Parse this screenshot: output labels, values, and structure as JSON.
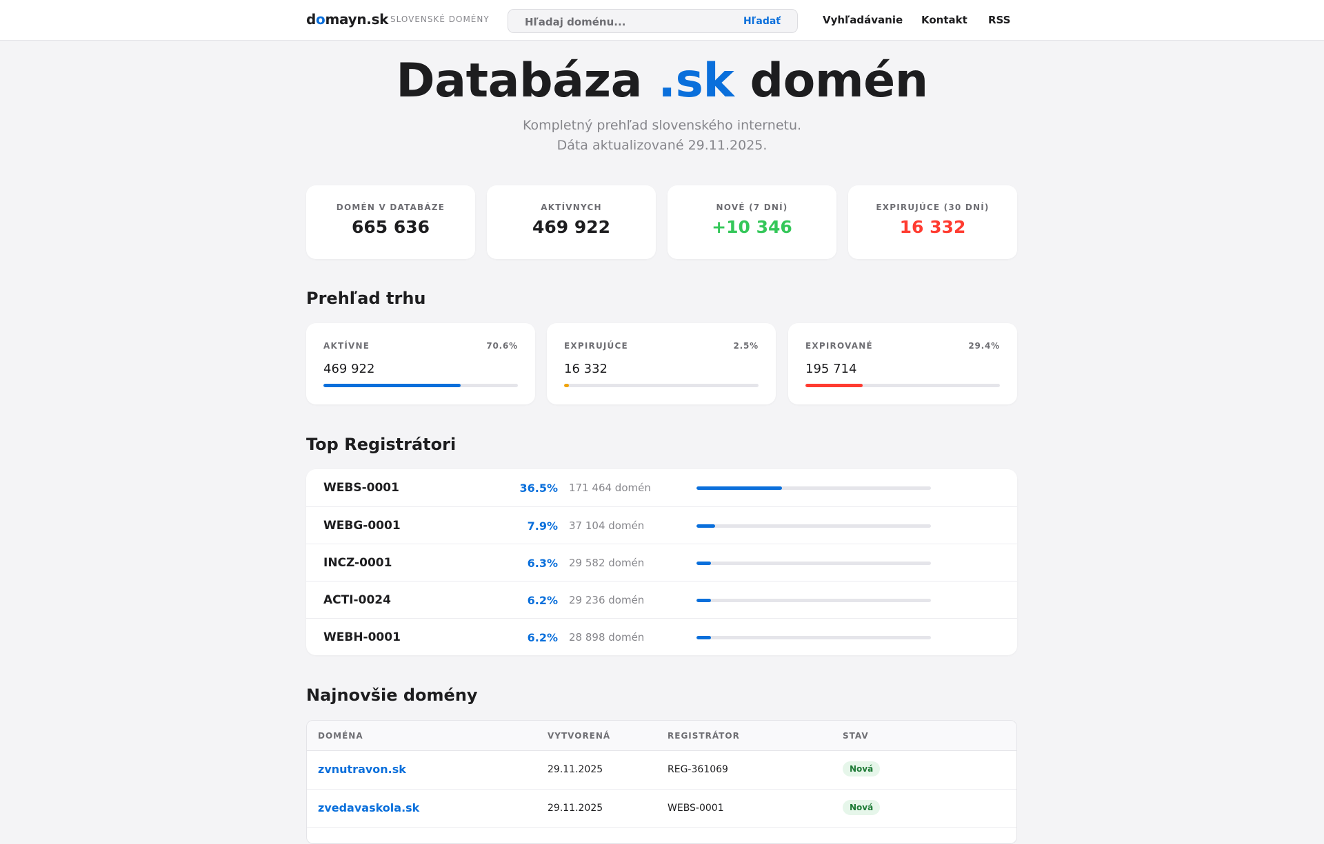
{
  "header": {
    "logo_prefix": "d",
    "logo_o": "o",
    "logo_suffix": "mayn.sk",
    "logo_tagline": "SLOVENSKÉ DOMÉNY",
    "search_placeholder": "Hľadaj doménu...",
    "search_button": "Hľadať",
    "nav": [
      "Vyhľadávanie",
      "Kontakt",
      "RSS"
    ]
  },
  "hero": {
    "title_before": "Databáza",
    "title_accent": ".sk",
    "title_after": "domén",
    "subtitle_line1": "Kompletný prehľad slovenského internetu.",
    "subtitle_line2": "Dáta aktualizované 29.11.2025."
  },
  "colors": {
    "accent": "#0a6fdb",
    "positive": "#34c759",
    "negative": "#ff3b30",
    "warning": "#f0a30a"
  },
  "stats": [
    {
      "label": "DOMÉN V DATABÁZE",
      "value": "665 636",
      "color": "#1d1d1f"
    },
    {
      "label": "AKTÍVNYCH",
      "value": "469 922",
      "color": "#1d1d1f"
    },
    {
      "label": "NOVÉ (7 DNÍ)",
      "value": "+10 346",
      "color": "#34c759"
    },
    {
      "label": "EXPIRUJÚCE (30 DNÍ)",
      "value": "16 332",
      "color": "#ff3b30"
    }
  ],
  "market": {
    "title": "Prehľad trhu",
    "cards": [
      {
        "label": "AKTÍVNE",
        "percent_text": "70.6%",
        "count": "469 922",
        "fraction": 0.706,
        "color": "#0a6fdb"
      },
      {
        "label": "EXPIRUJÚCE",
        "percent_text": "2.5%",
        "count": "16 332",
        "fraction": 0.025,
        "color": "#f0a30a"
      },
      {
        "label": "EXPIROVANÉ",
        "percent_text": "29.4%",
        "count": "195 714",
        "fraction": 0.294,
        "color": "#ff3b30"
      }
    ]
  },
  "registrars": {
    "title": "Top Registrátori",
    "rows": [
      {
        "name": "WEBS-0001",
        "percent_text": "36.5%",
        "count": "171 464 domén",
        "fraction": 0.365
      },
      {
        "name": "WEBG-0001",
        "percent_text": "7.9%",
        "count": "37 104 domén",
        "fraction": 0.079
      },
      {
        "name": "INCZ-0001",
        "percent_text": "6.3%",
        "count": "29 582 domén",
        "fraction": 0.063
      },
      {
        "name": "ACTI-0024",
        "percent_text": "6.2%",
        "count": "29 236 domén",
        "fraction": 0.062
      },
      {
        "name": "WEBH-0001",
        "percent_text": "6.2%",
        "count": "28 898 domén",
        "fraction": 0.062
      }
    ]
  },
  "newest": {
    "title": "Najnovšie domény",
    "columns": [
      "DOMÉNA",
      "VYTVORENÁ",
      "REGISTRÁTOR",
      "STAV"
    ],
    "rows": [
      {
        "domain": "zvnutravon.sk",
        "created": "29.11.2025",
        "registrar": "REG-361069",
        "status": "Nová"
      },
      {
        "domain": "zvedavaskola.sk",
        "created": "29.11.2025",
        "registrar": "WEBS-0001",
        "status": "Nová"
      }
    ]
  }
}
